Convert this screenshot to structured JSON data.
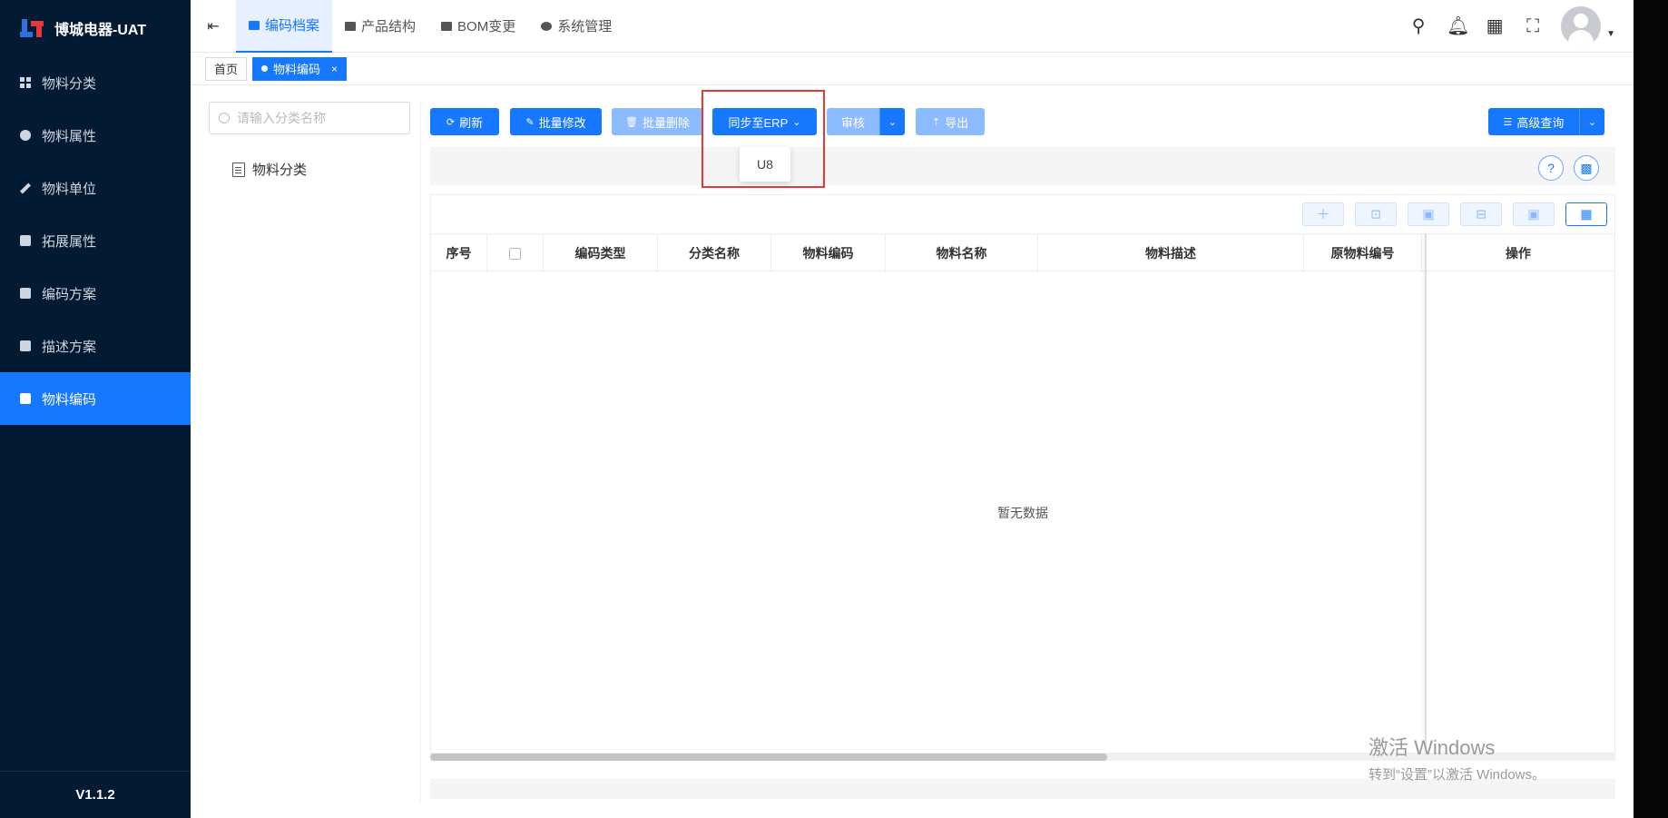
{
  "brand": {
    "name": "博城电器-UAT"
  },
  "sidebar": {
    "items": [
      {
        "label": "物料分类",
        "icon": "grid-icon"
      },
      {
        "label": "物料属性",
        "icon": "info-icon"
      },
      {
        "label": "物料单位",
        "icon": "pen-icon"
      },
      {
        "label": "拓展属性",
        "icon": "image-icon"
      },
      {
        "label": "编码方案",
        "icon": "box-icon"
      },
      {
        "label": "描述方案",
        "icon": "box-icon"
      },
      {
        "label": "物料编码",
        "icon": "doc-icon",
        "active": true
      }
    ],
    "version": "V1.1.2"
  },
  "topnav": {
    "tabs": [
      {
        "label": "编码档案",
        "active": true
      },
      {
        "label": "产品结构"
      },
      {
        "label": "BOM变更"
      },
      {
        "label": "系统管理"
      }
    ]
  },
  "tags": {
    "home": "首页",
    "current": "物料编码",
    "close": "×"
  },
  "tree": {
    "search_placeholder": "请输入分类名称",
    "root": "物料分类"
  },
  "toolbar": {
    "refresh": "刷新",
    "batch_edit": "批量修改",
    "batch_delete": "批量删除",
    "sync_erp": "同步至ERP",
    "audit": "审核",
    "export": "导出",
    "advanced_query": "高级查询"
  },
  "erp_dropdown": {
    "options": [
      "U8"
    ]
  },
  "table": {
    "columns": [
      "序号",
      "",
      "编码类型",
      "分类名称",
      "物料编码",
      "物料名称",
      "物料描述",
      "原物料编号",
      "操作"
    ],
    "empty_text": "暂无数据"
  },
  "watermark": {
    "line1": "激活 Windows",
    "line2": "转到“设置”以激活 Windows。"
  },
  "colors": {
    "primary": "#1677ff",
    "sidebar_bg": "#031a33",
    "highlight": "#e53935"
  }
}
